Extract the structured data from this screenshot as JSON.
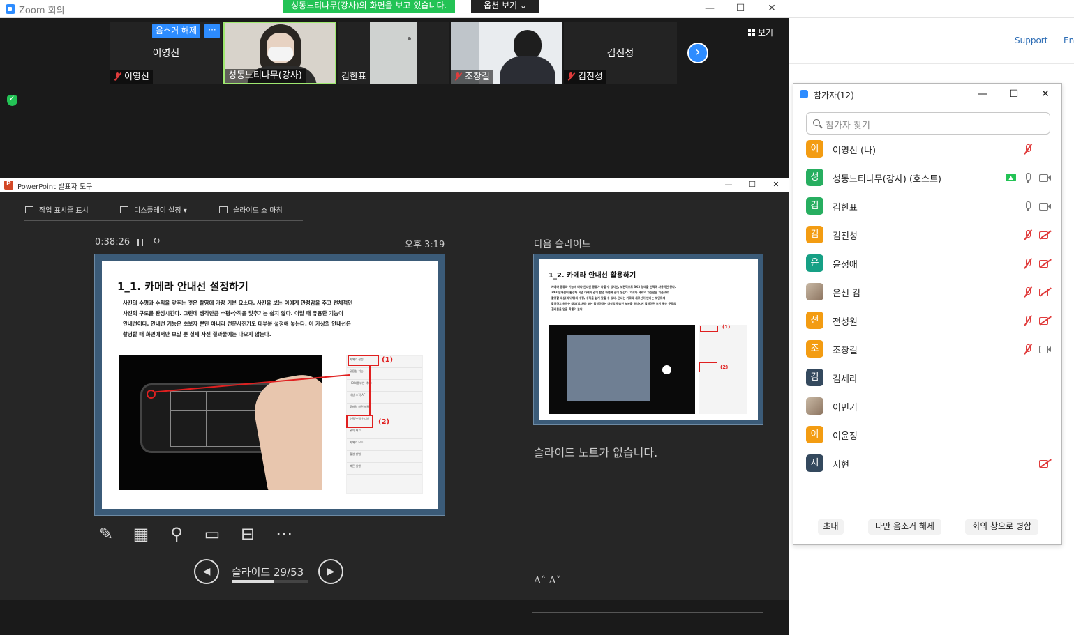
{
  "zoom": {
    "title": "Zoom 회의",
    "share_banner": "성동느티나무(강사)의 화면을 보고 있습니다.",
    "options_label": "옵션 보기 ⌄",
    "unmute_label": "음소거 해제",
    "more_label": "···",
    "view_label": "보기",
    "tiles": [
      {
        "big": "이영신",
        "name": "이영신"
      },
      {
        "big": "",
        "name": "성동느티나무(강사)"
      },
      {
        "big": "",
        "name": "김한표"
      },
      {
        "big": "",
        "name": "조창길"
      },
      {
        "big": "김진성",
        "name": "김진성"
      }
    ],
    "window_controls": {
      "min": "—",
      "max": "☐",
      "close": "✕"
    }
  },
  "ppt": {
    "title": "PowerPoint 발표자 도구",
    "toolbar": {
      "taskbar": "작업 표시줄 표시",
      "display": "디스플레이 설정 ▾",
      "end": "슬라이드 쇼 마침"
    },
    "timer": "0:38:26",
    "reset_icon": "↻",
    "clock": "오후 3:19",
    "next_label": "다음 슬라이드",
    "notes": "슬라이드 노트가 없습니다.",
    "font_controls": "A˄  A˅",
    "slide_counter": "슬라이드 29/53",
    "progress": 0.547,
    "prev_arrow": "◀",
    "next_arrow": "▶",
    "tool_icons": [
      "pen-icon",
      "see-all-slides-icon",
      "zoom-icon",
      "black-screen-icon",
      "subtitles-icon",
      "more-options-icon"
    ],
    "tool_glyphs": [
      "✎",
      "▦",
      "⚲",
      "▭",
      "⊟",
      "⋯"
    ],
    "current_slide": {
      "title": "1_1. 카메라 안내선 설정하기",
      "body_lines": [
        "사진의 수평과 수직을 맞추는 것은 촬영에 가장 기본 요소다. 사진을 보는 이에게 안정감을 주고 전체적인",
        "사진의 구도를 완성시킨다. 그런데 생각만큼 수평·수직을 맞추기는 쉽지 않다. 이럴 때 유용한 기능이",
        "안내선이다. 안내선 기능은 초보자 뿐만 아니라 전문사진가도 대부분 설정해 놓는다. 이 가상의 안내선은",
        "촬영할 때 화면에서만 보일 뿐 실제 사진 결과물에는 나오지 않는다."
      ],
      "marker1": "(1)",
      "marker2": "(2)",
      "settings_rows": [
        "카메라 설정",
        "유용한 기능",
        "HDR(풍부한 색조)",
        "대상 추적 AF",
        "모바일 화면 비율",
        "수직/수평 안내선",
        "위치 태그",
        "카메라 모드",
        "촬영 방법",
        "빠른 실행"
      ]
    },
    "next_slide": {
      "title": "1_2. 카메라 안내선 활용하기",
      "body_lines": [
        "카메라 종류와 기능에 따라 안내선 종류가 다를 수 있지만, 보편적으로 3X3 형태를 선택해 사용하면 좋다.",
        "3X3 안내선이 활성화 되면 아래와 같이 촬영 화면에 선이 생긴다. 가로와 세로의 가상선을 기준으로",
        "촬영할 대상(피사체)의 수평, 수직을 쉽게 맞출 수 있다. 안내선 가로와 세로선이 만나는 포인트에",
        "촬영하고 원하는 대상(피사체) 또는 촬영하려는 대상의 중요한 부분을 위치시켜 촬영하면 보기 좋은 구도의",
        "결과물을 얻을 확률이 높다."
      ],
      "marker1": "(1)",
      "marker2": "(2)"
    }
  },
  "browser": {
    "support": "Support",
    "lang": "En"
  },
  "participants": {
    "title": "참가자(12)",
    "search_placeholder": "참가자 찾기",
    "list": [
      {
        "initial": "이",
        "name": "이영신 (나)",
        "color": "#f39c12",
        "mic": "off",
        "cam": "none",
        "share": false
      },
      {
        "initial": "성",
        "name": "성동느티나무(강사) (호스트)",
        "color": "#27ae60",
        "mic": "on",
        "cam": "on",
        "share": true
      },
      {
        "initial": "김",
        "name": "김한표",
        "color": "#27ae60",
        "mic": "on",
        "cam": "on",
        "share": false
      },
      {
        "initial": "김",
        "name": "김진성",
        "color": "#f39c12",
        "mic": "off",
        "cam": "off",
        "share": false
      },
      {
        "initial": "윤",
        "name": "윤정애",
        "color": "#16a085",
        "mic": "off",
        "cam": "off",
        "share": false
      },
      {
        "initial": "",
        "name": "은선 김",
        "color": "photo",
        "mic": "off",
        "cam": "off",
        "share": false
      },
      {
        "initial": "전",
        "name": "전성원",
        "color": "#f39c12",
        "mic": "off",
        "cam": "off",
        "share": false
      },
      {
        "initial": "조",
        "name": "조창길",
        "color": "#f39c12",
        "mic": "off",
        "cam": "on",
        "share": false
      },
      {
        "initial": "김",
        "name": "김세라",
        "color": "#34495e",
        "mic": "none",
        "cam": "none",
        "share": false
      },
      {
        "initial": "",
        "name": "이민기",
        "color": "photo",
        "mic": "none",
        "cam": "none",
        "share": false
      },
      {
        "initial": "이",
        "name": "이윤정",
        "color": "#f39c12",
        "mic": "none",
        "cam": "none",
        "share": false
      },
      {
        "initial": "지",
        "name": "지현",
        "color": "#34495e",
        "mic": "none",
        "cam": "off",
        "share": false
      }
    ],
    "footer": {
      "invite": "초대",
      "unmute_me": "나만 음소거 해제",
      "merge": "회의 창으로 병합"
    }
  }
}
